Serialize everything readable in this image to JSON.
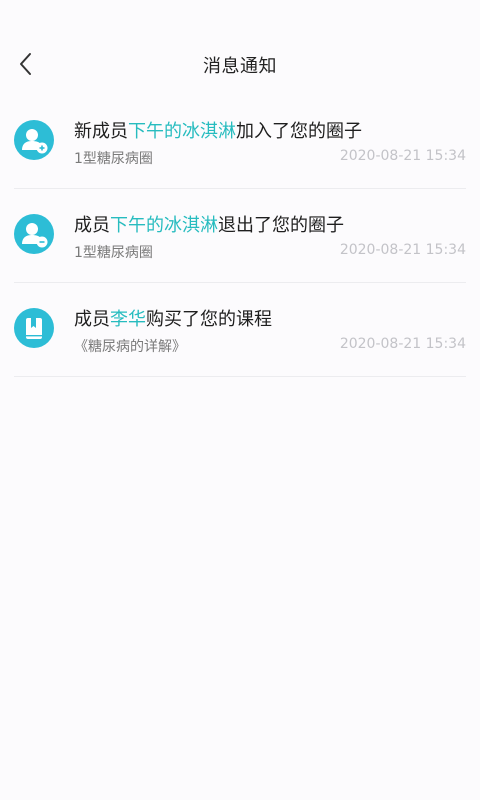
{
  "header": {
    "title": "消息通知",
    "back_icon": "chevron-left-icon"
  },
  "colors": {
    "accent": "#27bcbf",
    "avatar_bg": "#2dbdd6",
    "divider": "#ececef",
    "time_text": "#c3c3c8"
  },
  "notifications": [
    {
      "icon": "user-add-icon",
      "prefix": "新成员",
      "name": "下午的冰淇淋",
      "suffix": "加入了您的圈子",
      "subtitle": "1型糖尿病圈",
      "time": "2020-08-21 15:34"
    },
    {
      "icon": "user-remove-icon",
      "prefix": "成员",
      "name": "下午的冰淇淋",
      "suffix": "退出了您的圈子",
      "subtitle": "1型糖尿病圈",
      "time": "2020-08-21 15:34"
    },
    {
      "icon": "book-icon",
      "prefix": "成员",
      "name": "李华",
      "suffix": "购买了您的课程",
      "subtitle": "《糖尿病的详解》",
      "time": "2020-08-21 15:34"
    }
  ]
}
